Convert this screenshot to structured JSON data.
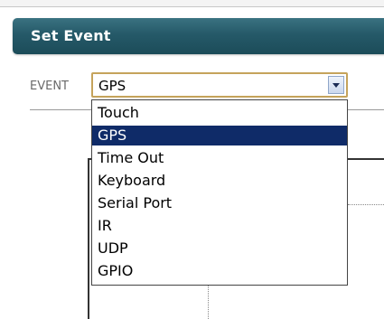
{
  "header": {
    "title": "Set Event"
  },
  "event": {
    "label": "EVENT",
    "selected_value": "GPS",
    "options": [
      "Touch",
      "GPS",
      "Time Out",
      "Keyboard",
      "Serial Port",
      "IR",
      "UDP",
      "GPIO"
    ],
    "selected_index": 1
  },
  "colors": {
    "header_bg": "#255968",
    "select_border": "#c5a35b",
    "selected_option_bg": "#0f2b68"
  }
}
